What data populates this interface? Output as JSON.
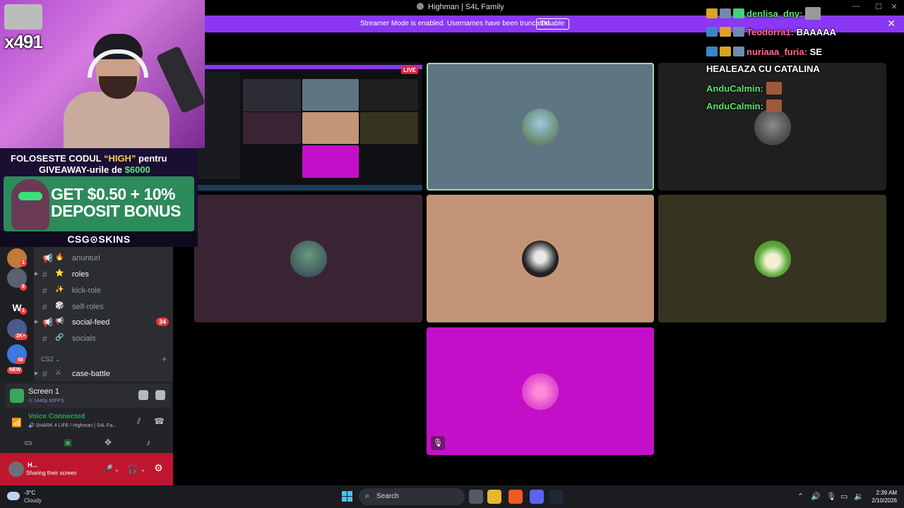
{
  "window": {
    "title": "Highman | S4L Family",
    "minimize": "—",
    "maximize": "☐",
    "close": "✕"
  },
  "banner": {
    "message": "Streamer Mode is enabled. Usernames have been truncated.",
    "disable_label": "Disable",
    "close": "✕"
  },
  "overlay": {
    "counter": "x491",
    "promo_line1_pre": "FOLOSESTE CODUL ",
    "promo_code": "“HIGH”",
    "promo_line1_post": " pentru",
    "promo_line2_pre": "GIVEAWAY-urile de ",
    "promo_amount": "$6000",
    "bonus_line1": "GET $0.50 + 10%",
    "bonus_line2": "DEPOSIT BONUS",
    "brand": "CSG⊙SKINS"
  },
  "chat": [
    {
      "user": "denlisa_dny",
      "sep": ":",
      "message": "",
      "color": "#57e46e"
    },
    {
      "user": "Teodorra1",
      "sep": ":",
      "message": " BAAAAA",
      "color": "#ff6b8b"
    },
    {
      "user": "nuriaaa_furia",
      "sep": ":",
      "message": " SE",
      "color": "#ff6b8b"
    },
    {
      "user": "",
      "sep": "",
      "message": "HEALEAZA CU CATALINA",
      "color": "#ffffff"
    },
    {
      "user": "AnduCalmin",
      "sep": ":",
      "message": "",
      "color": "#57e46e"
    },
    {
      "user": "AnduCalmin",
      "sep": ":",
      "message": "",
      "color": "#57e46e"
    }
  ],
  "share_preview": {
    "live_label": "LIVE"
  },
  "tiles_colors": {
    "t1": "#5e7682",
    "t2": "#1f1f1f",
    "t3": "#3a2433",
    "t4": "#c49478",
    "t5": "#363320",
    "t6": "#c40fc9"
  },
  "tile6_mute_icon": "🎙",
  "servers": [
    {
      "badge": "1"
    },
    {
      "badge": "8"
    },
    {
      "badge": "1"
    },
    {
      "badge": "2K+"
    },
    {
      "badge": "58"
    },
    {
      "badge": "NEW"
    }
  ],
  "channels": [
    {
      "emoji": "🔥",
      "name": "anunturi",
      "unread": false,
      "count": ""
    },
    {
      "emoji": "⭐",
      "name": "roles",
      "unread": true,
      "count": ""
    },
    {
      "emoji": "✨",
      "name": "kick-role",
      "unread": false,
      "count": ""
    },
    {
      "emoji": "🎲",
      "name": "self-roles",
      "unread": false,
      "count": ""
    },
    {
      "emoji": "📢",
      "name": "social-feed",
      "unread": true,
      "count": "34"
    },
    {
      "emoji": "🔗",
      "name": "socials",
      "unread": false,
      "count": ""
    },
    {
      "emoji": "⚔",
      "name": "case-battle",
      "unread": true,
      "count": ""
    }
  ],
  "category": {
    "name": "CS2 ⌄",
    "add": "+"
  },
  "panel": {
    "screen_title": "Screen 1",
    "screen_quality": "⊙ 1440p 60FPS",
    "voice_status": "Voice Connected",
    "voice_channel": "🔊 SHARK 4 LIFE / Highman | S4L Fa...",
    "user_name": "H...",
    "user_status": "Sharing their screen"
  },
  "taskbar": {
    "temperature": "-3°C",
    "condition": "Cloudy",
    "search_placeholder": "Search",
    "time": "2:39 AM",
    "date": "2/10/2026"
  }
}
